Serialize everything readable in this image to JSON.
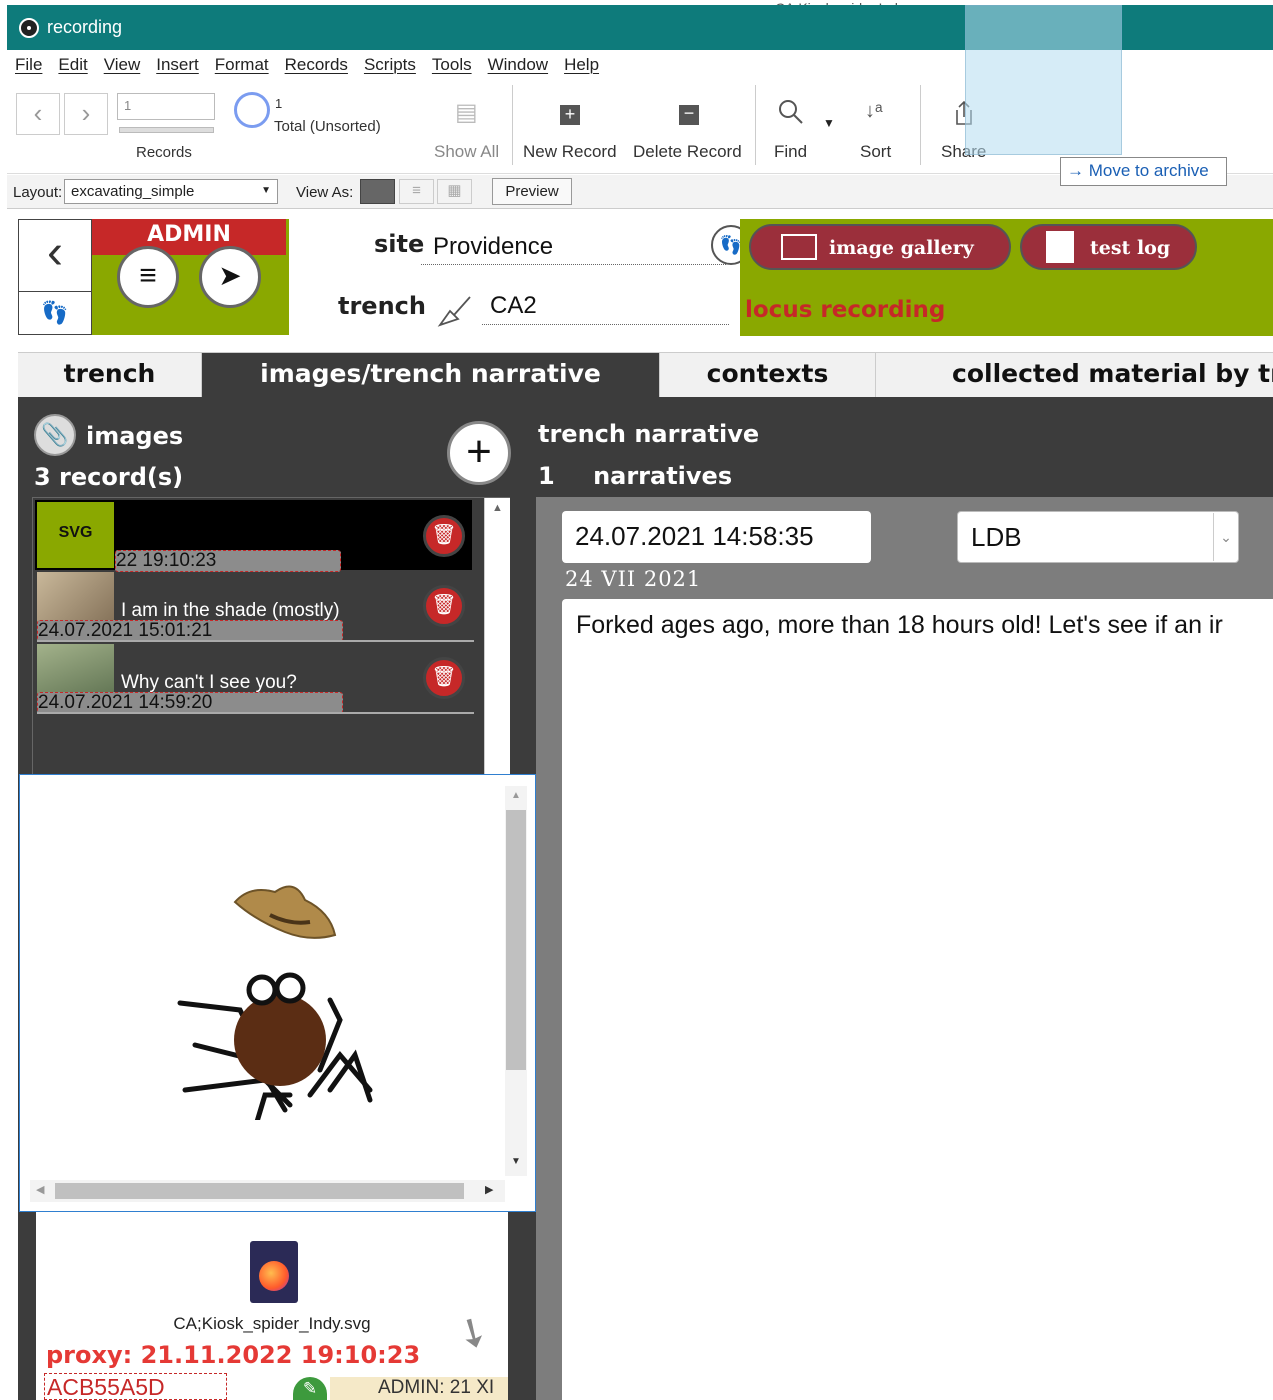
{
  "window": {
    "title": "recording",
    "background_window_title": "CA;Kiosk spider Indy.svg"
  },
  "menu": [
    "File",
    "Edit",
    "View",
    "Insert",
    "Format",
    "Records",
    "Scripts",
    "Tools",
    "Window",
    "Help"
  ],
  "toolbar": {
    "record_input": "1",
    "records_label": "Records",
    "found_count": "1",
    "total_label": "Total (Unsorted)",
    "show_all": "Show All",
    "new_record": "New Record",
    "delete_record": "Delete Record",
    "find": "Find",
    "sort": "Sort",
    "share": "Share"
  },
  "layoutbar": {
    "layout_label": "Layout:",
    "layout_value": "excavating_simple",
    "view_as_label": "View As:",
    "preview": "Preview"
  },
  "tooltip": {
    "move_to_archive": "Move to archive"
  },
  "header": {
    "admin": "ADMIN",
    "site_label": "site",
    "site_value": "Providence",
    "trench_label": "trench",
    "trench_value": "CA2",
    "image_gallery": "image gallery",
    "test_log": "test log",
    "locus_recording": "locus recording"
  },
  "tabs": [
    "trench",
    "images/trench narrative",
    "contexts",
    "collected material by tren"
  ],
  "images": {
    "title": "images",
    "count": "3 record(s)",
    "rows": [
      {
        "badge": "SVG",
        "title": "",
        "date": "22 19:10:23"
      },
      {
        "badge": "",
        "title": "I am in the shade (mostly)",
        "date": "24.07.2021 15:01:21"
      },
      {
        "badge": "",
        "title": "Why can't I see you?",
        "date": "24.07.2021 14:59:20"
      }
    ],
    "file_name": "CA;Kiosk_spider_Indy.svg",
    "proxy": "proxy: 21.11.2022 19:10:23",
    "hex_id": "ACB55A5D",
    "admin_badge": "ADMIN: 21 XI"
  },
  "narrative": {
    "title": "trench narrative",
    "count": "1",
    "count_label": "narratives",
    "datetime": "24.07.2021 14:58:35",
    "author": "LDB",
    "date_roman": "24 VII 2021",
    "text": "Forked ages ago, more than 18 hours old! Let's see if an ir"
  },
  "colors": {
    "titlebar": "#0e7b7b",
    "admin_red": "#c62828",
    "olive_green": "#8aa800",
    "pill_maroon": "#9b2f3b",
    "dark_panel": "#3c3c3c"
  }
}
